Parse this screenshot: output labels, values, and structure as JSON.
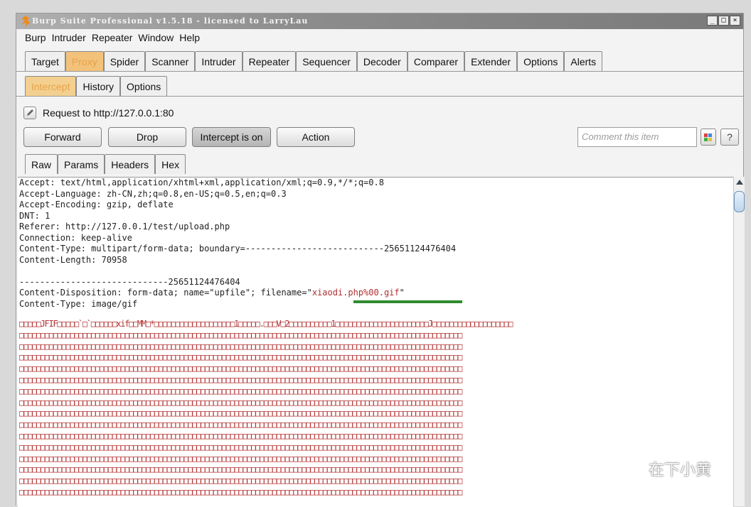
{
  "window": {
    "title": "Burp Suite Professional v1.5.18 - licensed to LarryLau",
    "minimize": "_",
    "restore": "□",
    "close": "×"
  },
  "menu": [
    "Burp",
    "Intruder",
    "Repeater",
    "Window",
    "Help"
  ],
  "main_tabs": [
    "Target",
    "Proxy",
    "Spider",
    "Scanner",
    "Intruder",
    "Repeater",
    "Sequencer",
    "Decoder",
    "Comparer",
    "Extender",
    "Options",
    "Alerts"
  ],
  "proxy_tabs": [
    "Intercept",
    "History",
    "Options"
  ],
  "request_label": "Request to http://127.0.0.1:80",
  "buttons": {
    "forward": "Forward",
    "drop": "Drop",
    "intercept": "Intercept is on",
    "action": "Action"
  },
  "comment_placeholder": "Comment this item",
  "help_label": "?",
  "view_tabs": [
    "Raw",
    "Params",
    "Headers",
    "Hex"
  ],
  "request_lines": [
    "Accept: text/html,application/xhtml+xml,application/xml;q=0.9,*/*;q=0.8",
    "Accept-Language: zh-CN,zh;q=0.8,en-US;q=0.5,en;q=0.3",
    "Accept-Encoding: gzip, deflate",
    "DNT: 1",
    "Referer: http://127.0.0.1/test/upload.php",
    "Connection: keep-alive",
    "Content-Type: multipart/form-data; boundary=---------------------------25651124476404",
    "Content-Length: 70958",
    "",
    "-----------------------------25651124476404"
  ],
  "disposition_prefix": "Content-Disposition: form-data; name=\"upfile\"; filename=\"",
  "filename": "xiaodi.php%00.gif",
  "disposition_suffix": "\"",
  "content_type_line": "Content-Type: image/gif",
  "binary_first_line": "□□□□□JFIF□□□□□`□`□□□□□□xif□□MM□*□□□□□□□□□□□□□□□□□□□1□□□□□.□□□V□2□□□□□□□□□□1□□□□□□□□□□□□□□□□□□□□□□J□□□□□□□□□□□□□□□□□□□",
  "binary_line": "□□□□□□□□□□□□□□□□□□□□□□□□□□□□□□□□□□□□□□□□□□□□□□□□□□□□□□□□□□□□□□□□□□□□□□□□□□□□□□□□□□□□□□□□□□□□□□□□□□□□□□□□□",
  "watermark": "在下小黄"
}
